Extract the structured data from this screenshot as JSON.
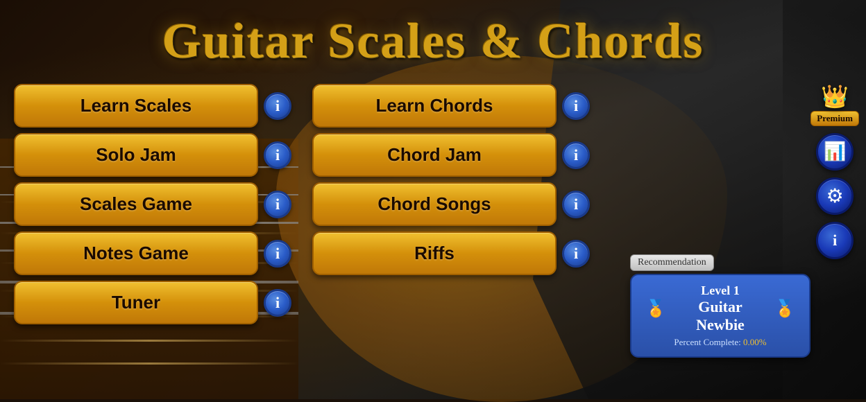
{
  "app": {
    "title": "Guitar Scales & Chords"
  },
  "menu": {
    "left": [
      {
        "id": "learn-scales",
        "label": "Learn Scales"
      },
      {
        "id": "solo-jam",
        "label": "Solo Jam"
      },
      {
        "id": "scales-game",
        "label": "Scales Game"
      },
      {
        "id": "notes-game",
        "label": "Notes Game"
      },
      {
        "id": "tuner",
        "label": "Tuner"
      }
    ],
    "right": [
      {
        "id": "learn-chords",
        "label": "Learn Chords"
      },
      {
        "id": "chord-jam",
        "label": "Chord Jam"
      },
      {
        "id": "chord-songs",
        "label": "Chord Songs"
      },
      {
        "id": "riffs",
        "label": "Riffs"
      }
    ]
  },
  "sidebar": {
    "premium_label": "Premium",
    "stats_icon": "📊",
    "settings_icon": "⚙",
    "info_icon": "ℹ"
  },
  "recommendation": {
    "label": "Recommendation",
    "level": "Level 1",
    "title": "Guitar Newbie",
    "percent_label": "Percent Complete:",
    "percent_value": "0.00%"
  },
  "info_symbol": "i"
}
